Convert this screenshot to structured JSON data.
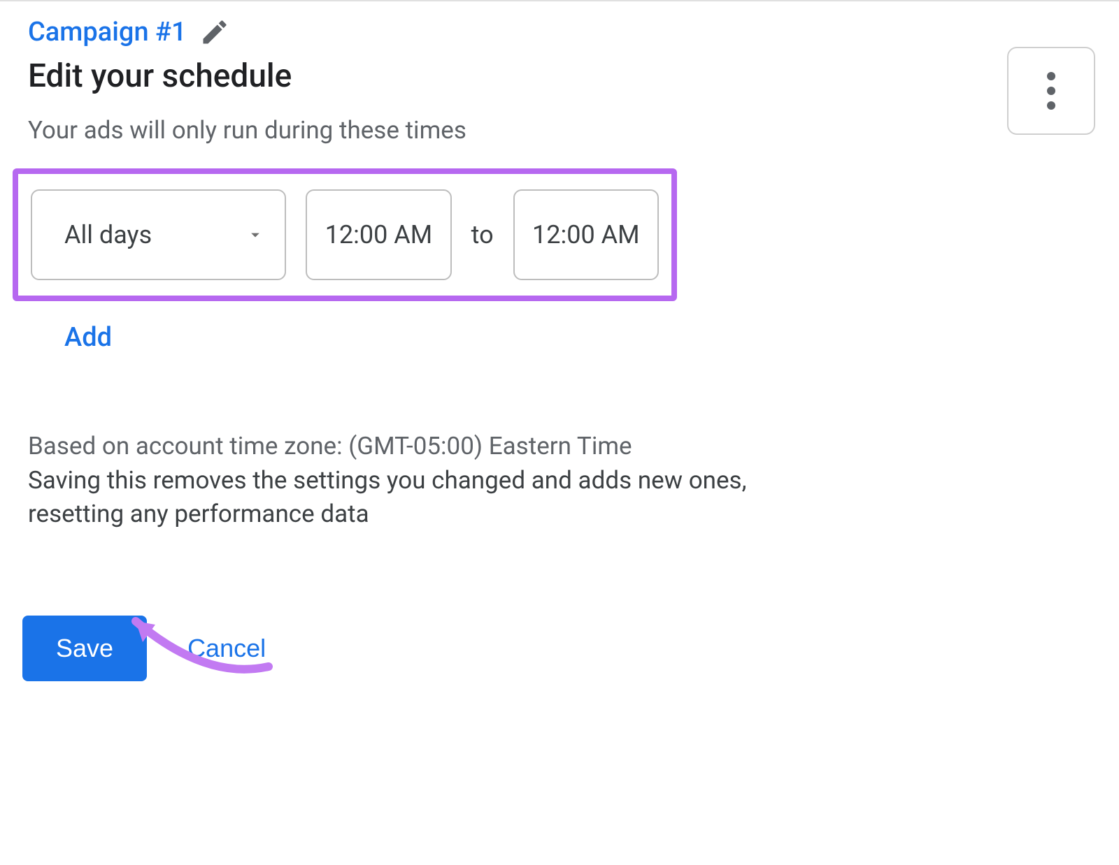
{
  "header": {
    "campaign_name": "Campaign #1",
    "title": "Edit your schedule",
    "subtitle": "Your ads will only run during these times"
  },
  "schedule_row": {
    "days_value": "All days",
    "start_time": "12:00 AM",
    "to_label": "to",
    "end_time": "12:00 AM"
  },
  "add_label": "Add",
  "timezone_note": "Based on account time zone: (GMT-05:00) Eastern Time",
  "warning_note": "Saving this removes the settings you changed and adds new ones, resetting any performance data",
  "buttons": {
    "save": "Save",
    "cancel": "Cancel"
  }
}
